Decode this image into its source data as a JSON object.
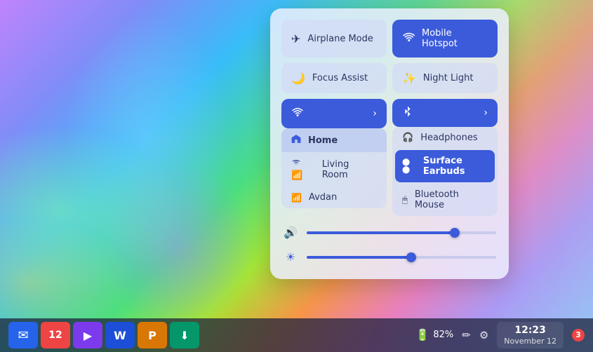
{
  "wallpaper": {
    "alt": "colorful abstract swirl wallpaper"
  },
  "quickSettings": {
    "tiles": [
      {
        "id": "airplane-mode",
        "label": "Airplane Mode",
        "icon": "✈",
        "active": false
      },
      {
        "id": "mobile-hotspot",
        "label": "Mobile Hotspot",
        "icon": "📶",
        "active": true
      },
      {
        "id": "focus-assist",
        "label": "Focus Assist",
        "icon": "🌙",
        "active": false
      },
      {
        "id": "night-light",
        "label": "Night Light",
        "icon": "✨",
        "active": false
      }
    ],
    "wifi": {
      "icon": "wifi",
      "chevron": "›",
      "networks": [
        {
          "id": "home",
          "label": "Home",
          "active": true
        },
        {
          "id": "living-room",
          "label": "Living Room",
          "active": false
        },
        {
          "id": "avdan",
          "label": "Avdan",
          "active": false
        }
      ]
    },
    "bluetooth": {
      "icon": "bluetooth",
      "chevron": "›",
      "devices": [
        {
          "id": "headphones",
          "label": "Headphones",
          "active": false,
          "icon": "🎧"
        },
        {
          "id": "surface-earbuds",
          "label": "Surface Earbuds",
          "active": true,
          "icon": "●"
        },
        {
          "id": "bluetooth-mouse",
          "label": "Bluetooth Mouse",
          "active": false,
          "icon": "🖱"
        }
      ]
    },
    "volumeSlider": {
      "icon": "🔊",
      "value": 78,
      "max": 100
    },
    "brightnessSlider": {
      "icon": "☀",
      "value": 55,
      "max": 100
    }
  },
  "taskbar": {
    "apps": [
      {
        "id": "mail",
        "icon": "✉",
        "color": "#2563eb",
        "label": "Mail"
      },
      {
        "id": "calendar",
        "icon": "12",
        "color": "#ef4444",
        "label": "Calendar"
      },
      {
        "id": "video",
        "icon": "▶",
        "color": "#7c3aed",
        "label": "Video"
      },
      {
        "id": "word",
        "icon": "W",
        "color": "#1d4ed8",
        "label": "Word"
      },
      {
        "id": "powerpoint",
        "icon": "P",
        "color": "#d97706",
        "label": "PowerPoint"
      },
      {
        "id": "downloader",
        "icon": "⬇",
        "color": "#059669",
        "label": "Downloader"
      }
    ],
    "battery": {
      "icon": "🔋",
      "percent": "82%",
      "label": "Battery"
    },
    "editIcon": "✏",
    "settingsIcon": "⚙",
    "clock": {
      "time": "12:23",
      "date": "November 12"
    },
    "notificationCount": "3"
  }
}
